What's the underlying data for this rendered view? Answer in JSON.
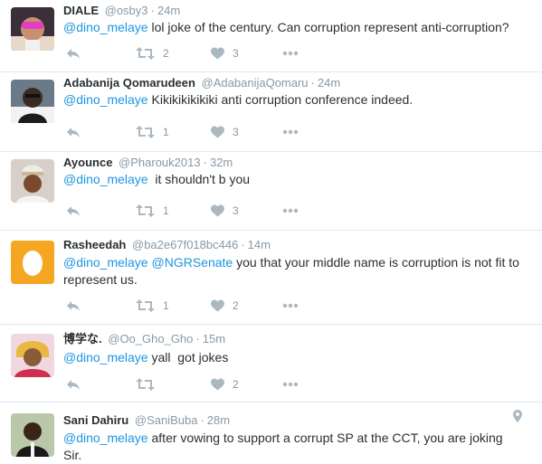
{
  "tweets": [
    {
      "name": "DIALE",
      "handle": "@osby3",
      "time": "24m",
      "mention": "@dino_melaye",
      "mention2": "",
      "text": " lol joke of the century. Can corruption represent anti-corruption?",
      "retweets": "2",
      "likes": "3"
    },
    {
      "name": "Adabanija Qomarudeen",
      "handle": "@AdabanijaQomaru",
      "time": "24m",
      "mention": "@dino_melaye",
      "mention2": "",
      "text": " Kikikikikikiki anti corruption conference indeed.",
      "retweets": "1",
      "likes": "3"
    },
    {
      "name": "Ayounce",
      "handle": "@Pharouk2013",
      "time": "32m",
      "mention": "@dino_melaye",
      "mention2": "",
      "text": "  it shouldn't b you",
      "retweets": "1",
      "likes": "3"
    },
    {
      "name": "Rasheedah",
      "handle": "@ba2e67f018bc446",
      "time": "14m",
      "mention": "@dino_melaye",
      "mention2": " @NGRSenate",
      "text": " you that your middle name is corruption is not fit to represent us.",
      "retweets": "1",
      "likes": "2"
    },
    {
      "name": "博学な.",
      "handle": "@Oo_Gho_Gho",
      "time": "15m",
      "mention": "@dino_melaye",
      "mention2": "",
      "text": " yall  got jokes",
      "retweets": "",
      "likes": "2"
    },
    {
      "name": "Sani Dahiru",
      "handle": "@SaniBuba",
      "time": "28m",
      "mention": "@dino_melaye",
      "mention2": "",
      "text": " after vowing to support a corrupt SP at the CCT, you are joking Sir.",
      "retweets": "",
      "likes": ""
    }
  ],
  "colors": {
    "mention": "#1b95e0",
    "meta": "#8899a6",
    "icon": "#aab8c2",
    "divider": "#e1e8ed"
  },
  "icons": [
    "reply-icon",
    "retweet-icon",
    "like-icon",
    "more-icon",
    "location-pin-icon"
  ]
}
